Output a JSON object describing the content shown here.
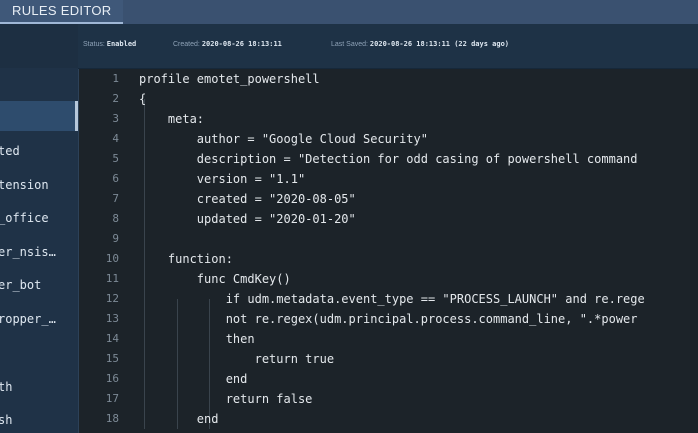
{
  "header": {
    "tab_label": "RULES EDITOR"
  },
  "status": {
    "status_label": "Status:",
    "status_value": "Enabled",
    "created_label": "Created:",
    "created_value": "2020-08-26 18:13:11",
    "saved_label": "Last Saved:",
    "saved_value": "2020-08-26 18:13:11 (22 days ago)"
  },
  "sidebar": {
    "items": [
      {
        "label": ""
      },
      {
        "label": "ted"
      },
      {
        "label": "tension"
      },
      {
        "label": "_office"
      },
      {
        "label": "er_nsis…"
      },
      {
        "label": "er_bot"
      },
      {
        "label": "ropper_…"
      },
      {
        "label": ""
      },
      {
        "label": "th"
      },
      {
        "label": "sh"
      }
    ]
  },
  "editor": {
    "lines": [
      {
        "n": "1",
        "text": "profile emotet_powershell"
      },
      {
        "n": "2",
        "text": "{"
      },
      {
        "n": "3",
        "text": "    meta:"
      },
      {
        "n": "4",
        "text": "        author = \"Google Cloud Security\""
      },
      {
        "n": "5",
        "text": "        description = \"Detection for odd casing of powershell command"
      },
      {
        "n": "6",
        "text": "        version = \"1.1\""
      },
      {
        "n": "7",
        "text": "        created = \"2020-08-05\""
      },
      {
        "n": "8",
        "text": "        updated = \"2020-01-20\""
      },
      {
        "n": "9",
        "text": ""
      },
      {
        "n": "10",
        "text": "    function:"
      },
      {
        "n": "11",
        "text": "        func CmdKey()"
      },
      {
        "n": "12",
        "text": "            if udm.metadata.event_type == \"PROCESS_LAUNCH\" and re.rege"
      },
      {
        "n": "13",
        "text": "            not re.regex(udm.principal.process.command_line, \".*power"
      },
      {
        "n": "14",
        "text": "            then"
      },
      {
        "n": "15",
        "text": "                return true"
      },
      {
        "n": "16",
        "text": "            end"
      },
      {
        "n": "17",
        "text": "            return false"
      },
      {
        "n": "18",
        "text": "        end"
      }
    ]
  }
}
